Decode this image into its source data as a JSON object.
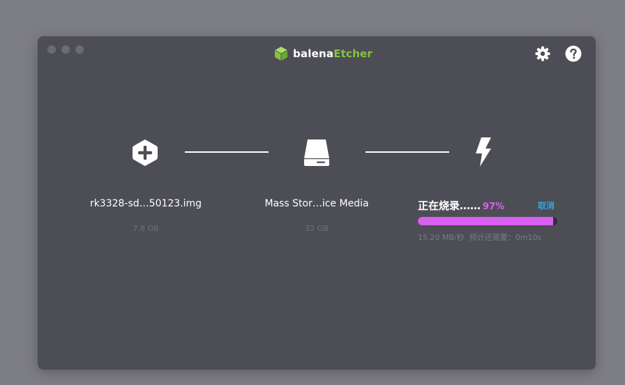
{
  "app": {
    "brand_part1": "balena",
    "brand_part2": "Etcher",
    "accent_green": "#85c440"
  },
  "toolbar": {
    "settings_icon": "gear-icon",
    "help_icon": "question-icon"
  },
  "steps": {
    "image": {
      "icon": "plus-hexagon-icon",
      "filename": "rk3328-sd…50123.img",
      "size": "7.8 GB"
    },
    "drive": {
      "icon": "drive-icon",
      "name": "Mass Stor…ice Media",
      "size": "32 GB"
    },
    "flash": {
      "icon": "lightning-icon",
      "status": "正在烧录……",
      "percent_label": "97%",
      "progress": 0.97,
      "cancel_label": "取消",
      "speed": "15.20 MB/秒",
      "eta": "预计还需要：0m10s",
      "progress_color": "#da60f1"
    }
  }
}
